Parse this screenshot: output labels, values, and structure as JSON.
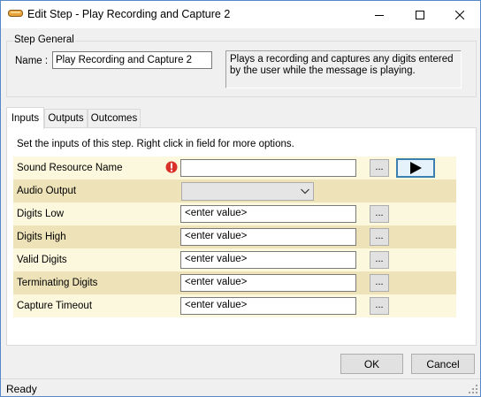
{
  "window": {
    "title": "Edit Step - Play Recording and Capture 2",
    "accent": "#3c7fb1"
  },
  "step_general": {
    "group_label": "Step General",
    "name_label": "Name :",
    "name_value": "Play Recording and Capture 2",
    "description": "Plays a recording and captures any digits entered by the user while the message is playing."
  },
  "tabs": [
    {
      "label": "Inputs",
      "active": true
    },
    {
      "label": "Outputs",
      "active": false
    },
    {
      "label": "Outcomes",
      "active": false
    }
  ],
  "inputs": {
    "instruction": "Set the inputs of this step.  Right click in field for more options.",
    "rows": [
      {
        "label": "Sound Resource Name",
        "value": "",
        "icon": "error-icon"
      },
      {
        "label": "Audio Output",
        "value": "",
        "control": "dropdown"
      },
      {
        "label": "Digits Low",
        "value": "<enter value>"
      },
      {
        "label": "Digits High",
        "value": "<enter value>"
      },
      {
        "label": "Valid Digits",
        "value": "<enter value>"
      },
      {
        "label": "Terminating Digits",
        "value": "<enter value>"
      },
      {
        "label": "Capture Timeout",
        "value": "<enter value>"
      }
    ],
    "ellipsis_label": "...",
    "row_colors": [
      "#fcf8dd",
      "#eee3b8"
    ]
  },
  "buttons": {
    "ok": "OK",
    "cancel": "Cancel"
  },
  "status": {
    "text": "Ready"
  }
}
